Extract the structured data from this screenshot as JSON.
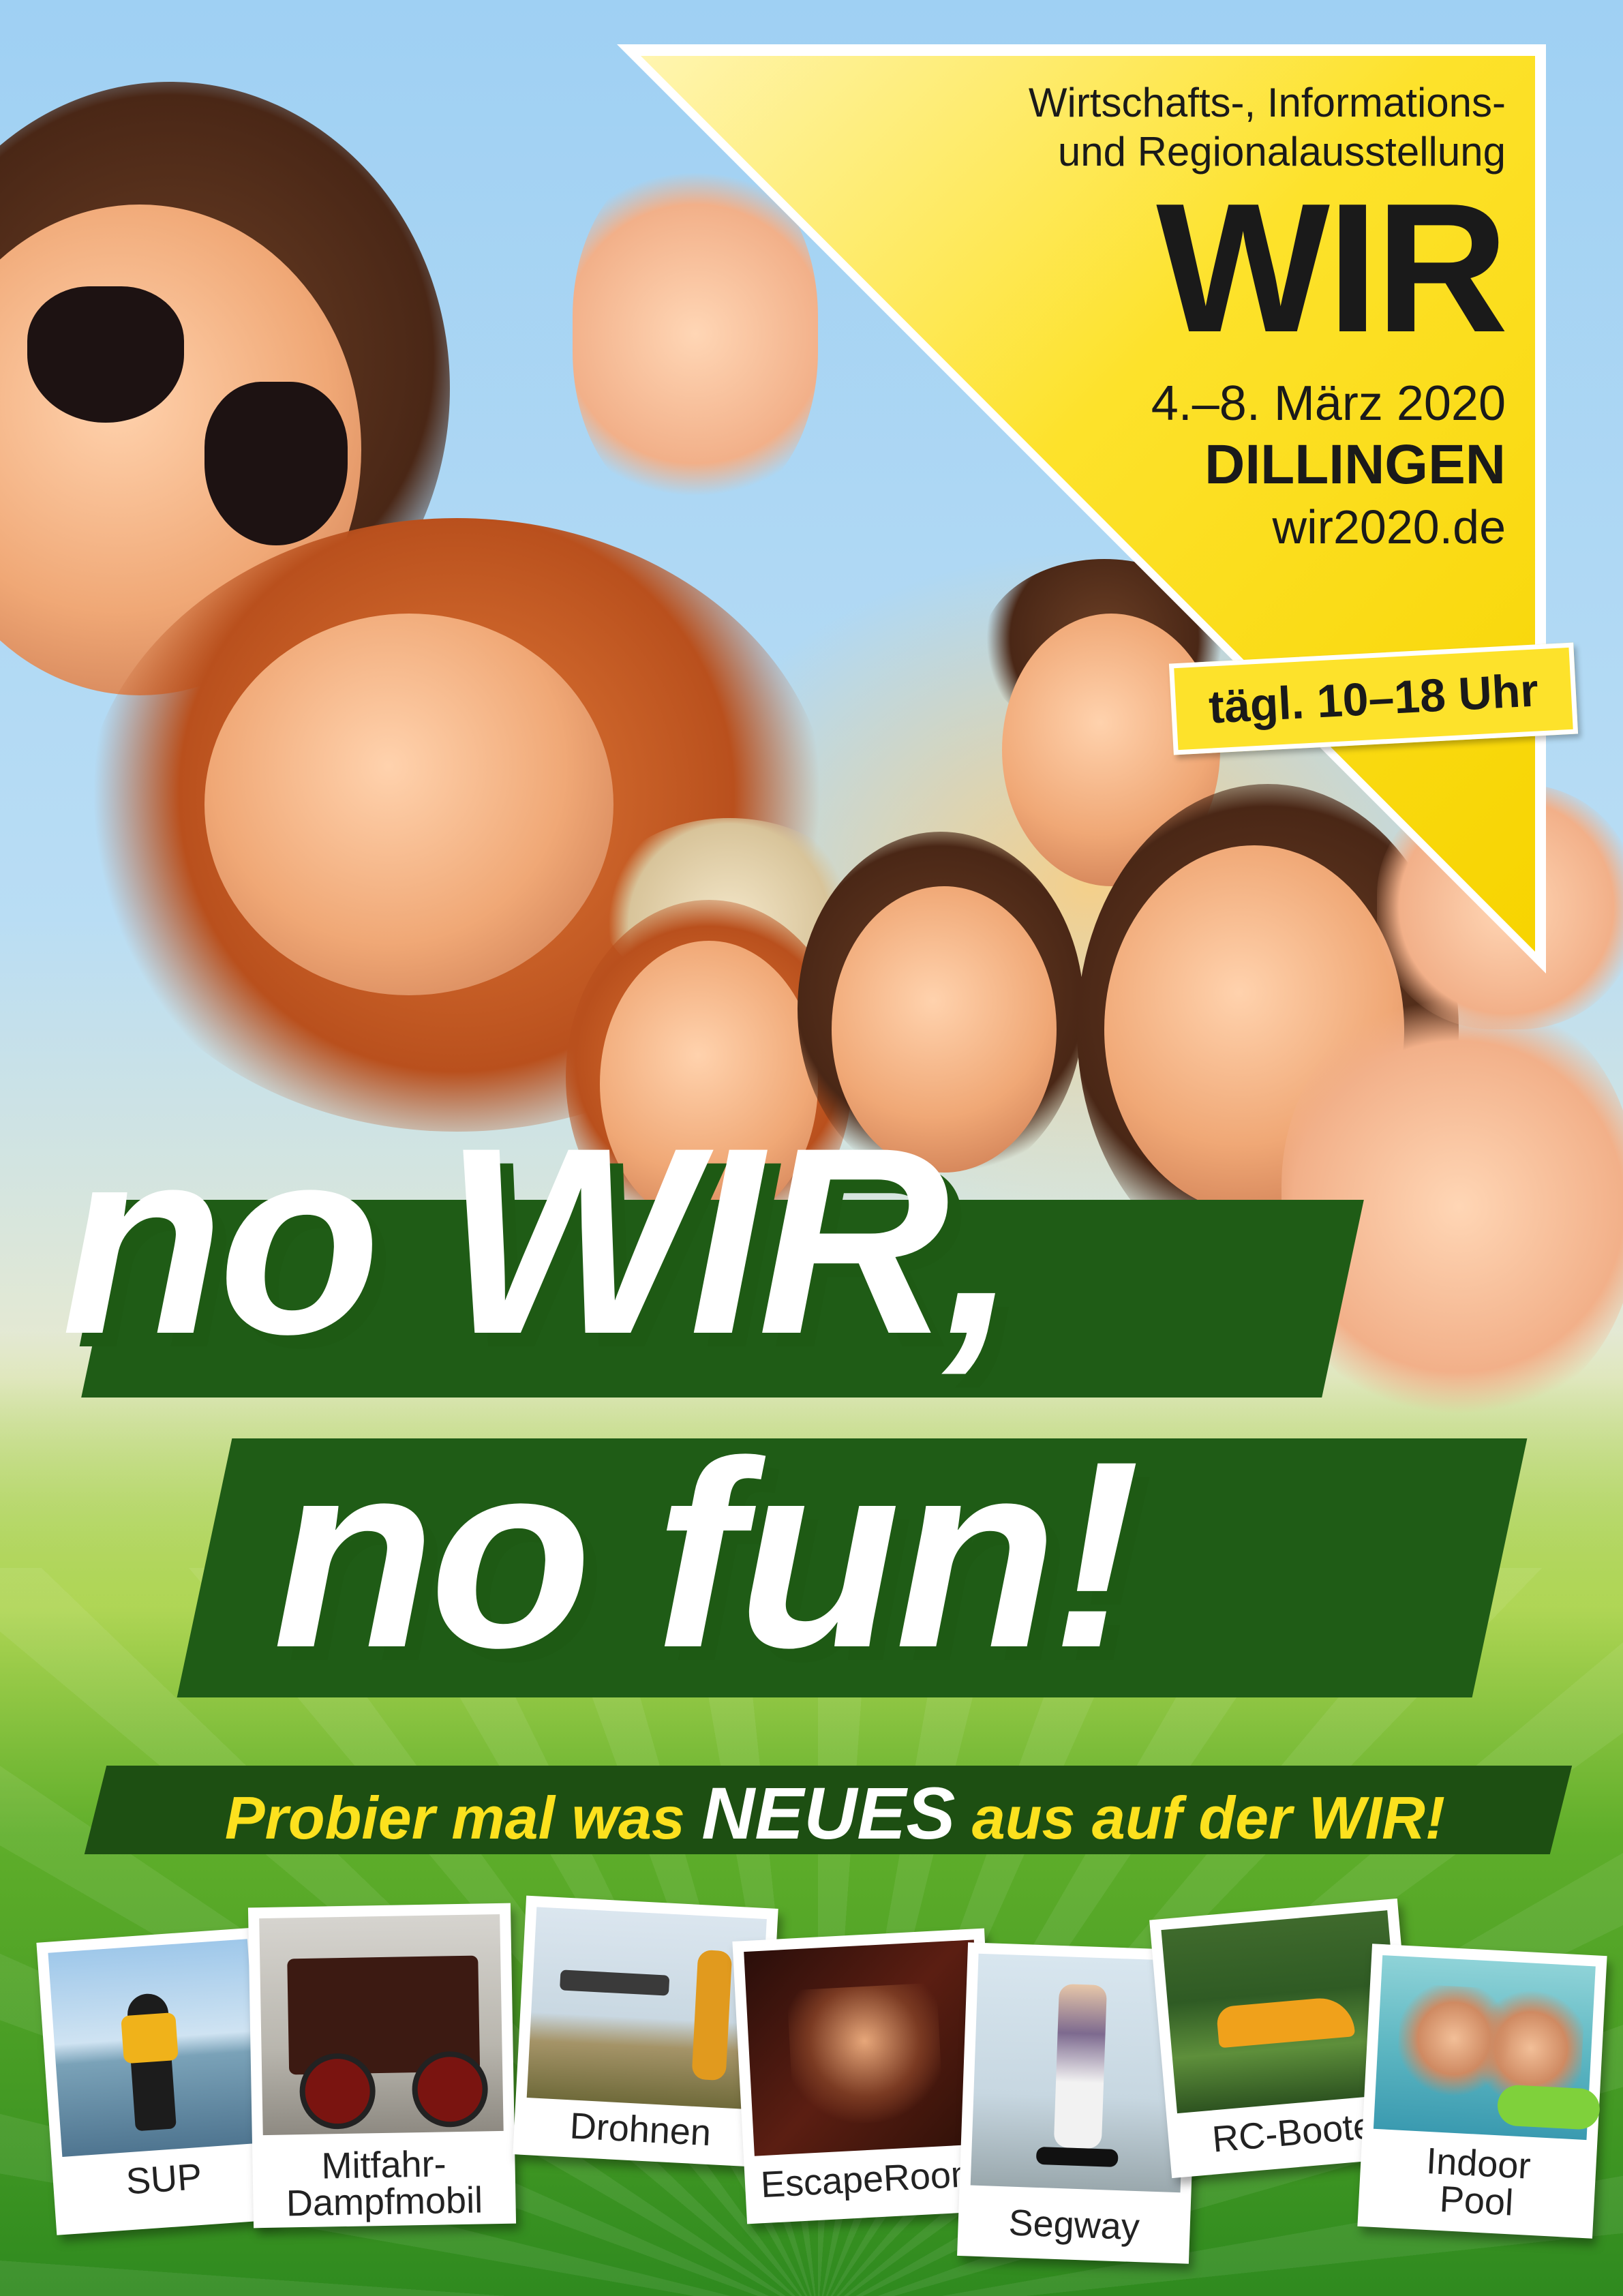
{
  "badge": {
    "line1": "Wirtschafts-, Informations-",
    "line2": "und Regionalausstellung",
    "title": "WIR",
    "date": "4.–8. März 2020",
    "city": "DILLINGEN",
    "url": "wir2020.de",
    "hours": "tägl. 10–18 Uhr",
    "color": "#fde22b"
  },
  "headline": {
    "line1": "no WIR,",
    "line2": "no fun!"
  },
  "tagline": {
    "part1": "Probier mal was ",
    "emphasis": "NEUES",
    "part2": " aus auf der WIR!"
  },
  "polaroids": [
    {
      "caption": "SUP"
    },
    {
      "caption_line1": "Mitfahr-",
      "caption_line2": "Dampfmobil"
    },
    {
      "caption": "Drohnen"
    },
    {
      "caption": "EscapeRoom"
    },
    {
      "caption": "Segway"
    },
    {
      "caption": "RC-Boote"
    },
    {
      "caption_line1": "Indoor",
      "caption_line2": "Pool"
    }
  ]
}
